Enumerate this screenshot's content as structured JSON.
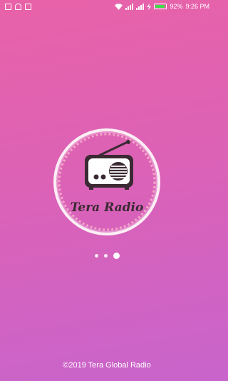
{
  "status_bar": {
    "left_icons": [
      "message-icon",
      "android-icon",
      "image-icon"
    ],
    "battery_percent": "92%",
    "time": "9:26 PM"
  },
  "splash": {
    "app_name": "Tera Radio",
    "logo_icon": "radio-icon",
    "page_indicator": {
      "total": 3,
      "active_index": 2
    }
  },
  "footer": {
    "copyright": "©2019 Tera Global Radio"
  },
  "colors": {
    "gradient_top": "#e862a8",
    "gradient_bottom": "#c864cc",
    "logo_dark": "#3b2a33",
    "battery": "#3fdc4a"
  }
}
